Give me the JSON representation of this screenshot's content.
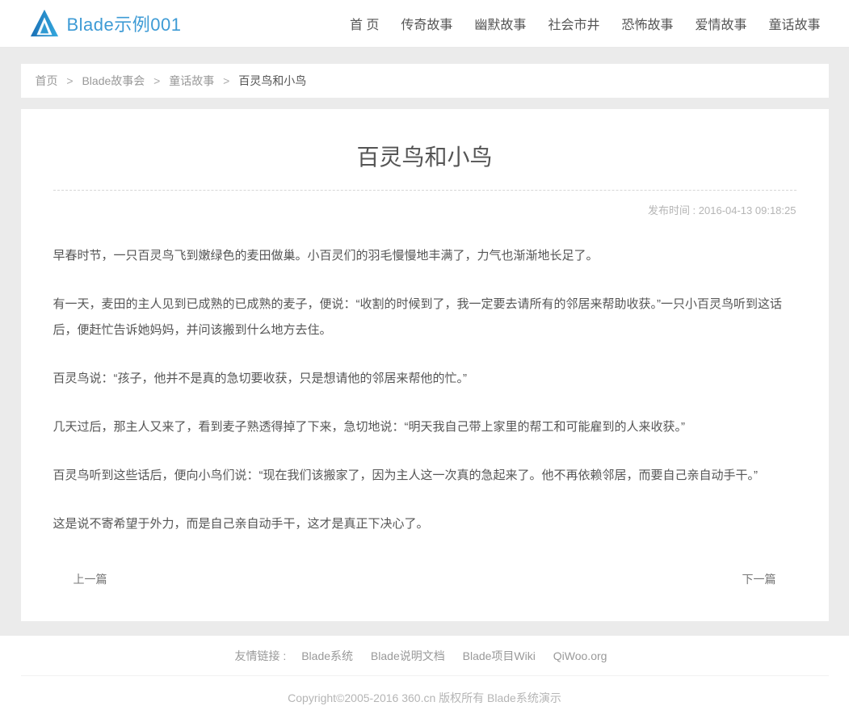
{
  "header": {
    "logo_text": "Blade示例001",
    "nav": [
      "首 页",
      "传奇故事",
      "幽默故事",
      "社会市井",
      "恐怖故事",
      "爱情故事",
      "童话故事"
    ]
  },
  "breadcrumb": {
    "separator": ">",
    "items": [
      "首页",
      "Blade故事会",
      "童话故事"
    ],
    "current": "百灵鸟和小鸟"
  },
  "article": {
    "title": "百灵鸟和小鸟",
    "publish": "发布时间 : 2016-04-13 09:18:25",
    "paragraphs": [
      "早春时节，一只百灵鸟飞到嫩绿色的麦田做巢。小百灵们的羽毛慢慢地丰满了，力气也渐渐地长足了。",
      "有一天，麦田的主人见到已成熟的已成熟的麦子，便说：“收割的时候到了，我一定要去请所有的邻居来帮助收获。”一只小百灵鸟听到这话后，便赶忙告诉她妈妈，并问该搬到什么地方去住。",
      "百灵鸟说：“孩子，他并不是真的急切要收获，只是想请他的邻居来帮他的忙。”",
      "几天过后，那主人又来了，看到麦子熟透得掉了下来，急切地说：“明天我自己带上家里的帮工和可能雇到的人来收获。”",
      "百灵鸟听到这些话后，便向小鸟们说：“现在我们该搬家了，因为主人这一次真的急起来了。他不再依赖邻居，而要自己亲自动手干。”",
      "这是说不寄希望于外力，而是自己亲自动手干，这才是真正下决心了。"
    ],
    "pager": {
      "prev": "上一篇",
      "next": "下一篇"
    }
  },
  "footer": {
    "links_label": "友情链接 :",
    "links": [
      "Blade系统",
      "Blade说明文档",
      "Blade项目Wiki",
      "QiWoo.org"
    ],
    "copyright": "Copyright©2005-2016 360.cn 版权所有 Blade系统演示"
  },
  "colors": {
    "brand": "#3e9bd5",
    "page_bg": "#ebebeb",
    "text": "#555555",
    "muted": "#999999",
    "light": "#b5b5b5"
  }
}
